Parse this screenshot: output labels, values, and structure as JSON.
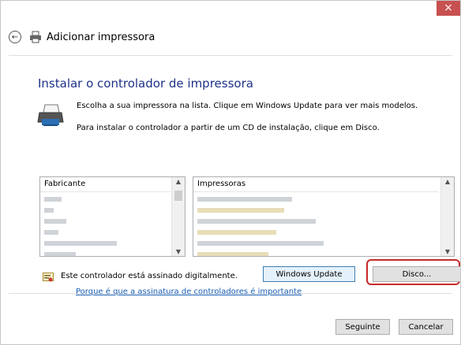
{
  "window": {
    "close_symbol": "×"
  },
  "header": {
    "title": "Adicionar impressora"
  },
  "main": {
    "title": "Instalar o controlador de impressora",
    "desc1": "Escolha a sua impressora na lista. Clique em Windows Update para ver mais modelos.",
    "desc2": "Para instalar o controlador a partir de um CD de instalação, clique em Disco."
  },
  "lists": {
    "manufacturer_header": "Fabricante",
    "printers_header": "Impressoras"
  },
  "signature": {
    "status": "Este controlador está assinado digitalmente.",
    "link": "Porque é que a assinatura de controladores é importante"
  },
  "buttons": {
    "windows_update": "Windows Update",
    "disk": "Disco...",
    "next": "Seguinte",
    "cancel": "Cancelar"
  },
  "icons": {
    "close": "close-icon",
    "back": "back-arrow-icon",
    "printer": "printer-icon",
    "shield": "certificate-icon"
  },
  "colors": {
    "title_blue": "#1e3287",
    "close_red": "#c75050",
    "highlight_red": "#c62a2a",
    "link_blue": "#1a5fb4"
  }
}
